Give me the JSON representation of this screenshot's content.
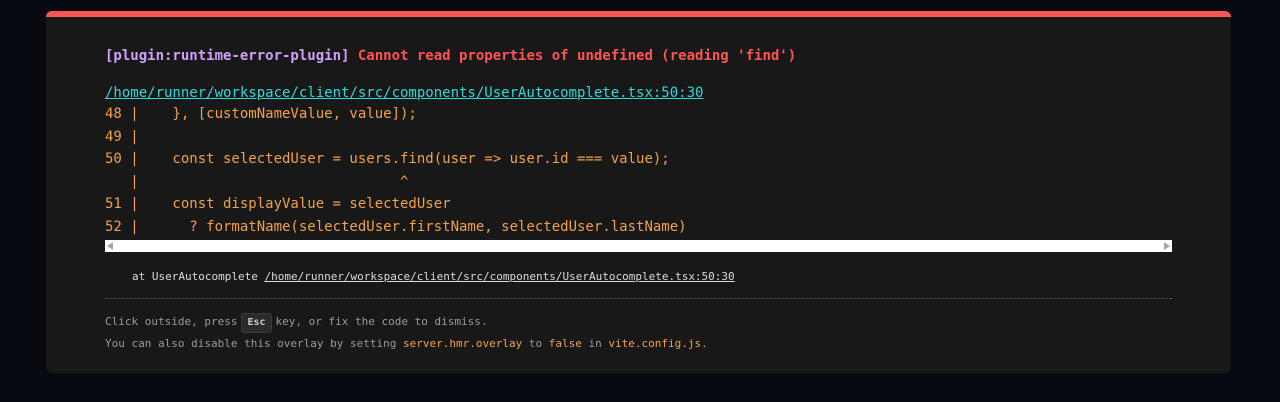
{
  "error": {
    "plugin": "[plugin:runtime-error-plugin]",
    "message": "Cannot read properties of undefined (reading 'find')",
    "file": "/home/runner/workspace/client/src/components/UserAutocomplete.tsx:50:30"
  },
  "frame": {
    "lines": [
      "48 |    }, [customNameValue, value]);",
      "49 |",
      "50 |    const selectedUser = users.find(user => user.id === value);",
      "   |                               ^",
      "51 |    const displayValue = selectedUser",
      "52 |      ? formatName(selectedUser.firstName, selectedUser.lastName)"
    ]
  },
  "stack": {
    "prefix": "at UserAutocomplete",
    "link": "/home/runner/workspace/client/src/components/UserAutocomplete.tsx:50:30"
  },
  "tips": {
    "line1_before": "Click outside, press",
    "key": "Esc",
    "line1_after": "key, or fix the code to dismiss.",
    "line2_a": "You can also disable this overlay by setting",
    "line2_code1": "server.hmr.overlay",
    "line2_b": "to",
    "line2_code2": "false",
    "line2_c": "in",
    "line2_code3": "vite.config.js",
    "line2_d": "."
  },
  "colors": {
    "accent_border": "#ff5555",
    "plugin": "#cfa2f9",
    "message": "#ff5555",
    "file_link": "#2dd9da",
    "code": "#f0a14a"
  }
}
